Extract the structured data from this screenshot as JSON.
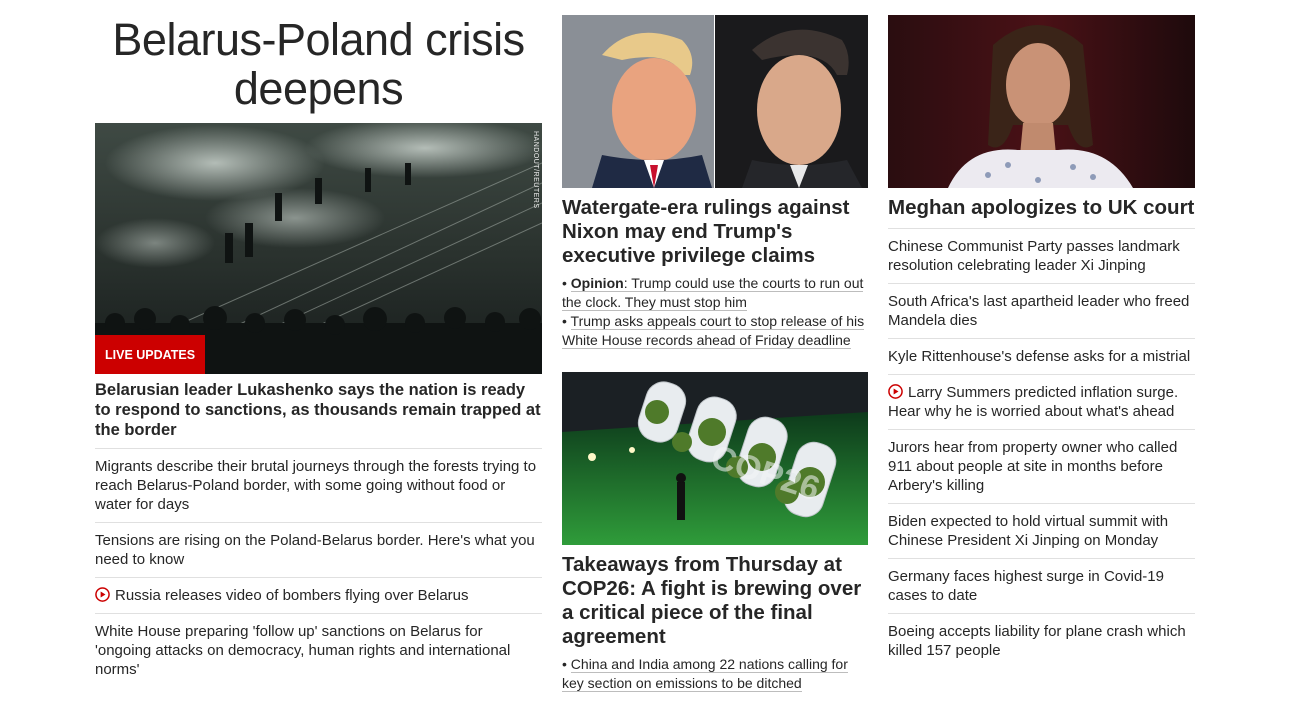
{
  "column1": {
    "banner": "Belarus-Poland crisis deepens",
    "photo_credit": "HANDOUT/REUTERS",
    "live_badge": "LIVE UPDATES",
    "lead_headline": "Belarusian leader Lukashenko says the nation is ready to respond to sanctions, as thousands remain trapped at the border",
    "stories": [
      {
        "text": "Migrants describe their brutal journeys through the forests trying to reach Belarus-Poland border, with some going without food or water for days",
        "video": false
      },
      {
        "text": "Tensions are rising on the Poland-Belarus border. Here's what you need to know",
        "video": false
      },
      {
        "text": "Russia releases video of bombers flying over Belarus",
        "video": true
      },
      {
        "text": "White House preparing 'follow up' sanctions on Belarus for 'ongoing attacks on democracy, human rights and international norms'",
        "video": false
      }
    ]
  },
  "column2": {
    "story1": {
      "headline": "Watergate-era rulings against Nixon may end Trump's executive privilege claims",
      "related": [
        {
          "prefix": "Opinion",
          "text": ": Trump could use the courts to run out the clock. They must stop him"
        },
        {
          "prefix": "",
          "text": "Trump asks appeals court to stop release of his White House records ahead of Friday deadline"
        }
      ]
    },
    "story2": {
      "headline": "Takeaways from Thursday at COP26: A fight is brewing over a critical piece of the final agreement",
      "sign_text": "COP26",
      "related": [
        {
          "prefix": "",
          "text": "China and India among 22 nations calling for key section on emissions to be ditched"
        }
      ]
    }
  },
  "column3": {
    "headline": "Meghan apologizes to UK court",
    "stories": [
      {
        "text": "Chinese Communist Party passes landmark resolution celebrating leader Xi Jinping",
        "video": false
      },
      {
        "text": "South Africa's last apartheid leader who freed Mandela dies",
        "video": false
      },
      {
        "text": "Kyle Rittenhouse's defense asks for a mistrial",
        "video": false
      },
      {
        "text": "Larry Summers predicted inflation surge. Hear why he is worried about what's ahead",
        "video": true
      },
      {
        "text": "Jurors hear from property owner who called 911 about people at site in months before Arbery's killing",
        "video": false
      },
      {
        "text": "Biden expected to hold virtual summit with Chinese President Xi Jinping on Monday",
        "video": false
      },
      {
        "text": "Germany faces highest surge in Covid-19 cases to date",
        "video": false
      },
      {
        "text": "Boeing accepts liability for plane crash which killed 157 people",
        "video": false
      }
    ]
  },
  "colors": {
    "accent_red": "#cc0000",
    "text": "#262626",
    "divider": "#e0e0e0"
  }
}
